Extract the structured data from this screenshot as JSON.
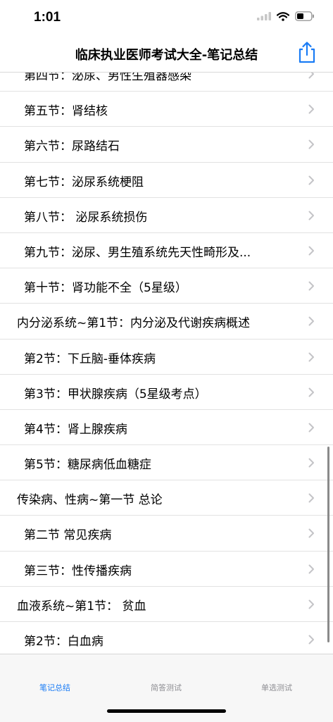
{
  "status": {
    "time": "1:01"
  },
  "header": {
    "title": "临床执业医师考试大全-笔记总结"
  },
  "list": {
    "items": [
      {
        "label": "第四节：泌尿、男性生殖器感染",
        "level": "sub"
      },
      {
        "label": "第五节：肾结核",
        "level": "sub"
      },
      {
        "label": "第六节：尿路结石",
        "level": "sub"
      },
      {
        "label": "第七节：泌尿系统梗阻",
        "level": "sub"
      },
      {
        "label": "第八节： 泌尿系统损伤",
        "level": "sub"
      },
      {
        "label": "第九节：泌尿、男生殖系统先天性畸形及...",
        "level": "sub"
      },
      {
        "label": "第十节：肾功能不全（5星级）",
        "level": "sub"
      },
      {
        "label": "内分泌系统~第1节：内分泌及代谢疾病概述",
        "level": "top"
      },
      {
        "label": "第2节：下丘脑-垂体疾病",
        "level": "sub"
      },
      {
        "label": "第3节：甲状腺疾病（5星级考点）",
        "level": "sub"
      },
      {
        "label": "第4节：肾上腺疾病",
        "level": "sub"
      },
      {
        "label": "第5节：糖尿病低血糖症",
        "level": "sub"
      },
      {
        "label": "传染病、性病~第一节  总论",
        "level": "top"
      },
      {
        "label": "第二节  常见疾病",
        "level": "sub"
      },
      {
        "label": "第三节：性传播疾病",
        "level": "sub"
      },
      {
        "label": "血液系统~第1节：  贫血",
        "level": "top"
      },
      {
        "label": "第2节：白血病",
        "level": "sub"
      }
    ]
  },
  "tabs": [
    {
      "label": "笔记总结",
      "active": true
    },
    {
      "label": "简答测试",
      "active": false
    },
    {
      "label": "单选测试",
      "active": false
    }
  ],
  "colors": {
    "accent": "#1a7cf5",
    "inactive": "#8e8e93",
    "chevron": "#c4c4c7"
  },
  "icons": {
    "share": "share-icon",
    "chevron": "chevron-right-icon",
    "wifi": "wifi-icon",
    "battery": "battery-icon",
    "signal": "signal-icon"
  }
}
